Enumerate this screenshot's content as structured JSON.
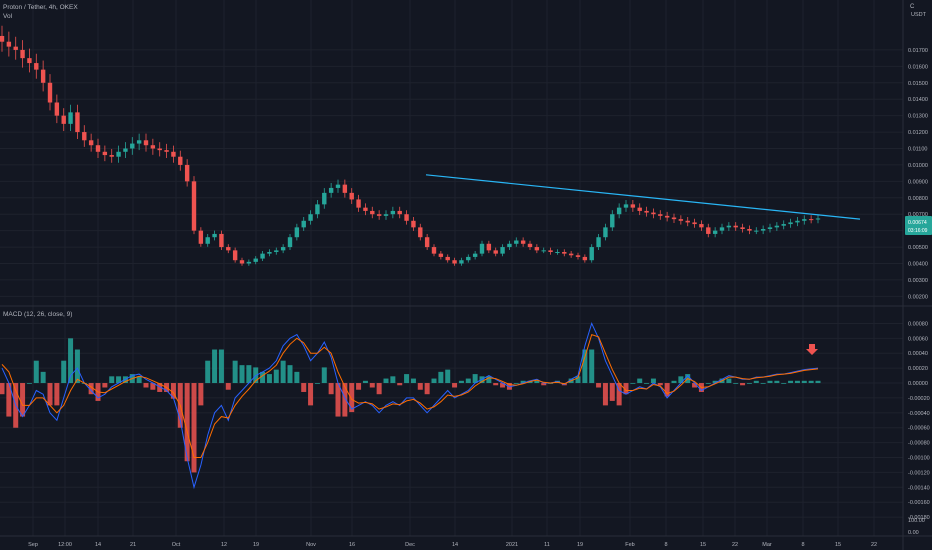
{
  "header": {
    "symbol_line": "Proton / Tether, 4h, OKEX",
    "vol_label": "Vol",
    "currency": "USDT",
    "corner_label": "C"
  },
  "macd_label": "MACD (12, 26, close, 9)",
  "price_tag": {
    "value": "0.00674",
    "sub": "03:16:09"
  },
  "chart_data": [
    {
      "type": "line",
      "title": "Proton / Tether, 4h, OKEX",
      "xlabel": "",
      "ylabel": "USDT",
      "x_ticks": [
        "Sep",
        "12:00",
        "14",
        "21",
        "Oct",
        "12",
        "19",
        "Nov",
        "16",
        "Dec",
        "14",
        "2021",
        "11",
        "19",
        "Feb",
        "8",
        "15",
        "22",
        "Mar",
        "8",
        "15",
        "22"
      ],
      "y_ticks": [
        "0.01700",
        "0.01600",
        "0.01500",
        "0.01400",
        "0.01300",
        "0.01200",
        "0.01100",
        "0.01000",
        "0.00900",
        "0.00800",
        "0.00700",
        "0.00600",
        "0.00500",
        "0.00400",
        "0.00300",
        "0.00200"
      ],
      "ylim": [
        0.0019,
        0.0187
      ],
      "series": [
        {
          "values": [
            0.0175,
            0.0172,
            0.017,
            0.0165,
            0.0162,
            0.0158,
            0.015,
            0.0138,
            0.013,
            0.0125,
            0.0132,
            0.012,
            0.0115,
            0.0112,
            0.0108,
            0.0106,
            0.0105,
            0.0108,
            0.011,
            0.0113,
            0.0115,
            0.0112,
            0.011,
            0.0109,
            0.0108,
            0.0105,
            0.01,
            0.009,
            0.006,
            0.0052,
            0.0056,
            0.0058,
            0.005,
            0.0048,
            0.0042,
            0.004,
            0.0041,
            0.0043,
            0.0046,
            0.0047,
            0.0048,
            0.005,
            0.0056,
            0.0062,
            0.0066,
            0.007,
            0.0076,
            0.0083,
            0.0086,
            0.0088,
            0.0083,
            0.0079,
            0.0074,
            0.0072,
            0.007,
            0.0069,
            0.007,
            0.0072,
            0.007,
            0.0066,
            0.0062,
            0.0056,
            0.005,
            0.0046,
            0.0044,
            0.0042,
            0.004,
            0.0042,
            0.0044,
            0.0046,
            0.0052,
            0.0048,
            0.0046,
            0.005,
            0.0052,
            0.0054,
            0.0052,
            0.005,
            0.0048,
            0.0048,
            0.0047,
            0.0047,
            0.0046,
            0.0045,
            0.0044,
            0.0042,
            0.005,
            0.0056,
            0.0062,
            0.007,
            0.0074,
            0.0076,
            0.0074,
            0.0072,
            0.0071,
            0.007,
            0.0069,
            0.0068,
            0.0067,
            0.0066,
            0.0065,
            0.0064,
            0.0062,
            0.0058,
            0.006,
            0.0062,
            0.0063,
            0.0062,
            0.0061,
            0.006,
            0.006,
            0.0061,
            0.0062,
            0.0063,
            0.0064,
            0.0065,
            0.0066,
            0.0067,
            0.00668,
            0.00674
          ],
          "color": "#26a69a"
        }
      ],
      "trendline": {
        "from": [
          "Dec",
          0.0094
        ],
        "to": [
          "22",
          0.0067
        ],
        "color": "#29b6f6"
      }
    },
    {
      "type": "bar",
      "title": "MACD (12, 26, close, 9)",
      "xlabel": "",
      "ylabel": "",
      "y_ticks": [
        "0.00080",
        "0.00060",
        "0.00040",
        "0.00020",
        "0.00000",
        "-0.00020",
        "-0.00040",
        "-0.00060",
        "-0.00080",
        "-0.00100",
        "-0.00120",
        "-0.00140",
        "-0.00160",
        "-0.00180",
        "100.00",
        "0.00"
      ],
      "ylim": [
        -0.002,
        0.0009
      ],
      "series": [
        {
          "name": "MACD",
          "color": "#2962ff",
          "values": [
            0.0002,
            0.0,
            -0.0003,
            -0.00045,
            -0.0003,
            -0.0001,
            -0.00015,
            -0.0004,
            -0.0005,
            -0.0002,
            0.0001,
            0.0002,
            0.0,
            -0.0001,
            -0.0002,
            -0.00015,
            -5e-05,
            0.0,
            5e-05,
            0.0001,
            0.00012,
            5e-05,
            0.0,
            -5e-05,
            -0.0001,
            -0.0002,
            -0.0005,
            -0.001,
            -0.0014,
            -0.0011,
            -0.0007,
            -0.0004,
            -0.0003,
            -0.0005,
            -0.0002,
            -0.0001,
            0.0,
            0.0001,
            0.00015,
            0.0002,
            0.0003,
            0.0005,
            0.0006,
            0.00065,
            0.0005,
            0.0003,
            0.0004,
            0.00055,
            0.00035,
            0.0,
            -0.0002,
            -0.00035,
            -0.0003,
            -0.00025,
            -0.0003,
            -0.0004,
            -0.0003,
            -0.00025,
            -0.0003,
            -0.0002,
            -0.0002,
            -0.0003,
            -0.0004,
            -0.0003,
            -0.0002,
            -0.0001,
            -0.0002,
            -0.00015,
            -0.0001,
            0.0,
            5e-05,
            0.0001,
            5e-05,
            0.0,
            -5e-05,
            -3e-05,
            0.0,
            3e-05,
            5e-05,
            0.0,
            0.0,
            2e-05,
            -2e-05,
            5e-05,
            0.0001,
            0.0005,
            0.0008,
            0.0006,
            0.0003,
            0.0001,
            -0.0001,
            -0.00015,
            -0.0001,
            -5e-05,
            -8e-05,
            0.0,
            -5e-05,
            -0.0002,
            -0.0001,
            0.0,
            0.0001,
            0.0,
            -0.0001,
            -5e-05,
            0.0,
            5e-05,
            0.0001,
            8e-05,
            5e-05,
            5e-05,
            8e-05,
            8e-05,
            0.0001,
            0.00012,
            0.00012,
            0.00014,
            0.00016,
            0.00018,
            0.00019,
            0.0002
          ]
        },
        {
          "name": "Signal",
          "color": "#ff6d00",
          "values": [
            0.00025,
            0.00015,
            -0.0001,
            -0.0003,
            -0.0003,
            -0.0002,
            -0.0002,
            -0.0003,
            -0.0004,
            -0.0003,
            -0.0001,
            5e-05,
            0.0,
            -5e-05,
            -0.00012,
            -0.00013,
            -8e-05,
            -3e-05,
            2e-05,
            6e-05,
            9e-05,
            7e-05,
            3e-05,
            -1e-05,
            -6e-05,
            -0.00013,
            -0.0003,
            -0.00065,
            -0.001,
            -0.001,
            -0.0008,
            -0.00055,
            -0.00045,
            -0.00047,
            -0.0003,
            -0.00018,
            -8e-05,
            3e-05,
            0.0001,
            0.00016,
            0.00024,
            0.0004,
            0.00052,
            0.0006,
            0.00054,
            0.0004,
            0.0004,
            0.00048,
            0.0004,
            0.00015,
            -5e-05,
            -0.00022,
            -0.00027,
            -0.00026,
            -0.00028,
            -0.00035,
            -0.00032,
            -0.00028,
            -0.00029,
            -0.00024,
            -0.00022,
            -0.00027,
            -0.00035,
            -0.00032,
            -0.00025,
            -0.00016,
            -0.00018,
            -0.00016,
            -0.00012,
            -4e-05,
            2e-05,
            7e-05,
            6e-05,
            2e-05,
            -2e-05,
            -3e-05,
            -1e-05,
            2e-05,
            4e-05,
            1e-05,
            0.0,
            1e-05,
            -1e-05,
            3e-05,
            7e-05,
            0.00035,
            0.00065,
            0.00062,
            0.0004,
            0.00018,
            0.0,
            -0.0001,
            -0.0001,
            -7e-05,
            -8e-05,
            -2e-05,
            -4e-05,
            -0.00014,
            -0.00011,
            -3e-05,
            6e-05,
            2e-05,
            -6e-05,
            -5e-05,
            -1e-05,
            3e-05,
            8e-05,
            8e-05,
            6e-05,
            5e-05,
            7e-05,
            8e-05,
            9e-05,
            0.00011,
            0.00012,
            0.00013,
            0.00015,
            0.00017,
            0.00018,
            0.00019
          ]
        }
      ],
      "arrow": {
        "at": "Mar",
        "color": "#ef5350"
      }
    }
  ]
}
